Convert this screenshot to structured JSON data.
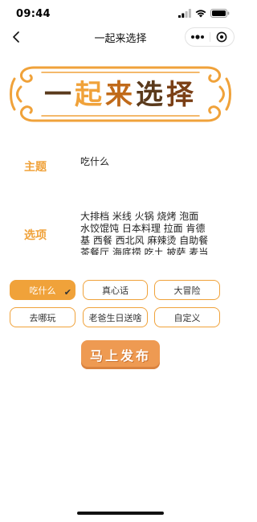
{
  "status": {
    "time": "09:44"
  },
  "nav": {
    "title": "一起来选择"
  },
  "banner": {
    "chars": [
      "一",
      "起",
      "来",
      "选",
      "择"
    ]
  },
  "form": {
    "topic_label": "主题",
    "topic_value": "吃什么",
    "options_label": "选项",
    "options_value": "大排档 米线 火锅 烧烤 泡面 水饺馄饨 日本料理 拉面 肯德基 西餐 西北风 麻辣烫 自助餐 茶餐厅 海底捞 吃土 披萨 麦当劳 汉堡 沙县小吃"
  },
  "presets": [
    {
      "label": "吃什么",
      "selected": true
    },
    {
      "label": "真心话",
      "selected": false
    },
    {
      "label": "大冒险",
      "selected": false
    },
    {
      "label": "去哪玩",
      "selected": false
    },
    {
      "label": "老爸生日送啥",
      "selected": false
    },
    {
      "label": "自定义",
      "selected": false
    }
  ],
  "check_glyph": "✔",
  "publish_label": "马上发布",
  "colors": {
    "accent": "#f0a23a",
    "publish": "#ee9a52",
    "banner_dark": "#5a3a1c"
  }
}
